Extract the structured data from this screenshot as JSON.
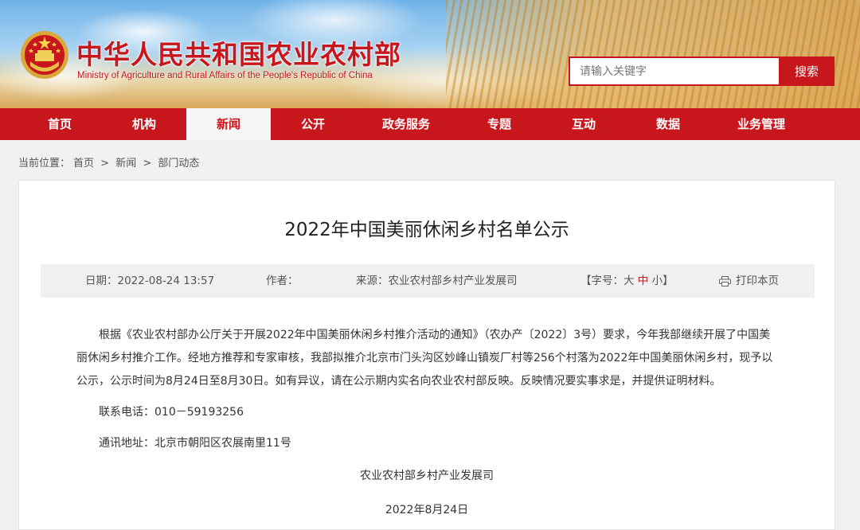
{
  "header": {
    "title": "中华人民共和国农业农村部",
    "subtitle": "Ministry of Agriculture and Rural Affairs of the People's Republic of China",
    "emblem_icon": "national-emblem-icon",
    "search_placeholder": "请输入关键字",
    "search_button": "搜索",
    "brand_color": "#c8161d"
  },
  "nav": {
    "items": [
      "首页",
      "机构",
      "新闻",
      "公开",
      "政务服务",
      "专题",
      "互动",
      "数据",
      "业务管理"
    ],
    "active": "新闻"
  },
  "breadcrumb": {
    "prefix": "当前位置：",
    "items": [
      "首页",
      "新闻",
      "部门动态"
    ],
    "separator": ">"
  },
  "article": {
    "title": "2022年中国美丽休闲乡村名单公示",
    "meta": {
      "date_label": "日期：",
      "date": "2022-08-24 13:57",
      "author_label": "作者：",
      "author": "",
      "source_label": "来源：",
      "source": "农业农村部乡村产业发展司",
      "font_label": "【字号：",
      "font_large": "大",
      "font_medium": "中",
      "font_small": "小",
      "font_close": "】",
      "print_label": "打印本页",
      "print_icon": "printer-icon"
    },
    "paragraph": "根据《农业农村部办公厅关于开展2022年中国美丽休闲乡村推介活动的通知》（农办产〔2022〕3号）要求，今年我部继续开展了中国美丽休闲乡村推介工作。经地方推荐和专家审核，我部拟推介北京市门头沟区妙峰山镇炭厂村等256个村落为2022年中国美丽休闲乡村，现予以公示，公示时间为8月24日至8月30日。如有异议，请在公示期内实名向农业农村部反映。反映情况要实事求是，并提供证明材料。",
    "phone": "联系电话：010－59193256",
    "address": "通讯地址：北京市朝阳区农展南里11号",
    "signature": "农业农村部乡村产业发展司",
    "sign_date": "2022年8月24日"
  }
}
